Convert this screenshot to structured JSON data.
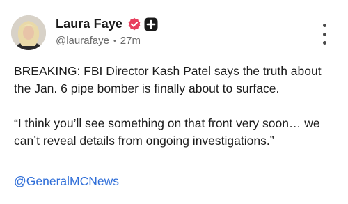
{
  "post": {
    "author": {
      "display_name": "Laura Faye",
      "handle": "@laurafaye",
      "time_ago": "27m",
      "separator": "•",
      "verified_color": "#e8405f",
      "badge_color": "#1a1a1a"
    },
    "body": {
      "paragraph1": "BREAKING: FBI Director Kash Patel says the truth about the Jan. 6 pipe bomber is finally about to surface.",
      "paragraph2": "“I think you’ll see something on that front very soon… we can’t reveal details from ongoing investigations.”"
    },
    "mention": "@GeneralMCNews",
    "mention_color": "#2f6ed8",
    "icons": {
      "verified": "verified-badge-icon",
      "plus": "plus-badge-icon",
      "more": "more-vertical-icon"
    }
  }
}
